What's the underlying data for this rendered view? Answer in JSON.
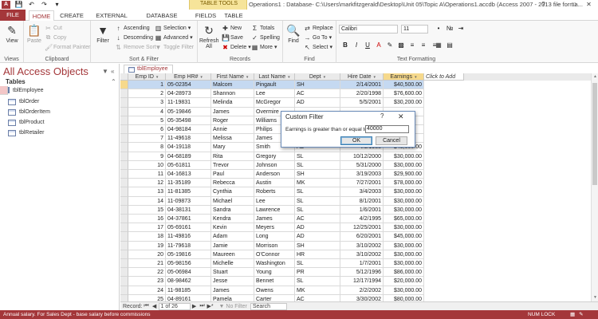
{
  "window": {
    "title": "Operations1 : Database- C:\\Users\\markfitzgerald\\Desktop\\Unit 05\\Topic A\\Operations1.accdb (Access 2007 - 2013 file forma...",
    "controls": [
      "?",
      "–",
      "□",
      "✕"
    ]
  },
  "quick_access": [
    "save-icon",
    "undo-icon",
    "redo-icon",
    "customize-icon"
  ],
  "ribbon_tabs": {
    "file": "FILE",
    "home": "HOME",
    "create": "CREATE",
    "external": "EXTERNAL DATA",
    "dbtools": "DATABASE TOOLS",
    "fields": "FIELDS",
    "table": "TABLE",
    "context_title": "TABLE TOOLS"
  },
  "ribbon": {
    "views": {
      "view": "View",
      "group": "Views"
    },
    "clipboard": {
      "paste": "Paste",
      "cut": "Cut",
      "copy": "Copy",
      "format_painter": "Format Painter",
      "group": "Clipboard"
    },
    "sort_filter": {
      "filter": "Filter",
      "ascending": "Ascending",
      "descending": "Descending",
      "remove_sort": "Remove Sort",
      "selection": "Selection",
      "advanced": "Advanced",
      "toggle_filter": "Toggle Filter",
      "group": "Sort & Filter"
    },
    "records": {
      "refresh": "Refresh",
      "refresh2": "All",
      "new": "New",
      "save": "Save",
      "delete": "Delete",
      "totals": "Totals",
      "spelling": "Spelling",
      "more": "More",
      "group": "Records"
    },
    "find": {
      "find": "Find",
      "replace": "Replace",
      "goto": "Go To",
      "select": "Select",
      "group": "Find"
    },
    "text_formatting": {
      "font": "Calibri",
      "size": "11",
      "bold": "B",
      "italic": "I",
      "underline": "U",
      "group": "Text Formatting"
    }
  },
  "nav_pane": {
    "title": "All Access Objects",
    "section": "Tables",
    "items": [
      "tblEmployee",
      "tblOrder",
      "tblOrderItem",
      "tblProduct",
      "tblRetailer"
    ]
  },
  "document": {
    "tab": "tblEmployee",
    "columns": [
      "Emp ID",
      "Emp HR#",
      "First Name",
      "Last Name",
      "Dept",
      "Hire Date",
      "Earnings",
      "Click to Add"
    ],
    "rows": [
      [
        "1",
        "05-02354",
        "Malcom",
        "Pingault",
        "SH",
        "2/14/2001",
        "$40,500.00"
      ],
      [
        "2",
        "04-28973",
        "Shannon",
        "Lee",
        "AC",
        "2/20/1998",
        "$76,600.00"
      ],
      [
        "3",
        "11-19831",
        "Melinda",
        "McGregor",
        "AD",
        "5/5/2001",
        "$30,200.00"
      ],
      [
        "4",
        "05-19846",
        "James",
        "Overmire",
        "",
        "",
        ""
      ],
      [
        "5",
        "05-35498",
        "Roger",
        "Williams",
        "",
        "",
        ""
      ],
      [
        "6",
        "04-98184",
        "Annie",
        "Philips",
        "",
        "",
        ""
      ],
      [
        "7",
        "11-49618",
        "Melissa",
        "James",
        "",
        "",
        ""
      ],
      [
        "8",
        "04-19118",
        "Mary",
        "Smith",
        "AD",
        "4/9/1988",
        "$45,000.00"
      ],
      [
        "9",
        "04-68189",
        "Rita",
        "Gregory",
        "SL",
        "10/12/2000",
        "$30,000.00"
      ],
      [
        "10",
        "05-61811",
        "Trevor",
        "Johnson",
        "SL",
        "5/31/2000",
        "$30,000.00"
      ],
      [
        "11",
        "04-16813",
        "Paul",
        "Anderson",
        "SH",
        "3/19/2003",
        "$29,900.00"
      ],
      [
        "12",
        "11-35189",
        "Rebecca",
        "Austin",
        "MK",
        "7/27/2001",
        "$78,000.00"
      ],
      [
        "13",
        "11-81385",
        "Cynthia",
        "Roberts",
        "SL",
        "3/4/2003",
        "$30,000.00"
      ],
      [
        "14",
        "11-09873",
        "Michael",
        "Lee",
        "SL",
        "8/1/2001",
        "$30,000.00"
      ],
      [
        "15",
        "04-38131",
        "Sandra",
        "Lawrence",
        "SL",
        "1/6/2001",
        "$30,000.00"
      ],
      [
        "16",
        "04-37861",
        "Kendra",
        "James",
        "AC",
        "4/2/1995",
        "$65,000.00"
      ],
      [
        "17",
        "05-69161",
        "Kevin",
        "Meyers",
        "AD",
        "12/25/2001",
        "$30,000.00"
      ],
      [
        "18",
        "11-49816",
        "Adam",
        "Long",
        "AD",
        "6/20/2001",
        "$45,000.00"
      ],
      [
        "19",
        "11-79618",
        "Jamie",
        "Morrison",
        "SH",
        "3/10/2002",
        "$30,000.00"
      ],
      [
        "20",
        "05-19816",
        "Maureen",
        "O'Connor",
        "HR",
        "3/10/2002",
        "$30,000.00"
      ],
      [
        "21",
        "05-98156",
        "Michelle",
        "Washington",
        "SL",
        "1/7/2001",
        "$30,000.00"
      ],
      [
        "22",
        "05-06984",
        "Stuart",
        "Young",
        "PR",
        "5/12/1996",
        "$86,000.00"
      ],
      [
        "23",
        "08-98462",
        "Jesse",
        "Bennet",
        "SL",
        "12/17/1994",
        "$20,000.00"
      ],
      [
        "24",
        "11-98185",
        "James",
        "Owens",
        "MK",
        "2/2/2002",
        "$30,000.00"
      ],
      [
        "25",
        "04-89161",
        "Pamela",
        "Carter",
        "AC",
        "3/30/2002",
        "$80,000.00"
      ]
    ],
    "record_nav": {
      "label": "Record:",
      "position": "1 of 26",
      "no_filter": "No Filter",
      "search": "Search"
    }
  },
  "dialog": {
    "title": "Custom Filter",
    "help": "?",
    "close": "✕",
    "label": "Earnings is greater than or equal to",
    "value": "40000",
    "ok": "OK",
    "cancel": "Cancel"
  },
  "status": {
    "message": "Annual salary. For Sales Dept - base salary before commissions",
    "num_lock": "NUM LOCK"
  },
  "colors": {
    "accent": "#a4373a",
    "highlight": "#f6d98c",
    "selected_row": "#c5d9f1"
  }
}
